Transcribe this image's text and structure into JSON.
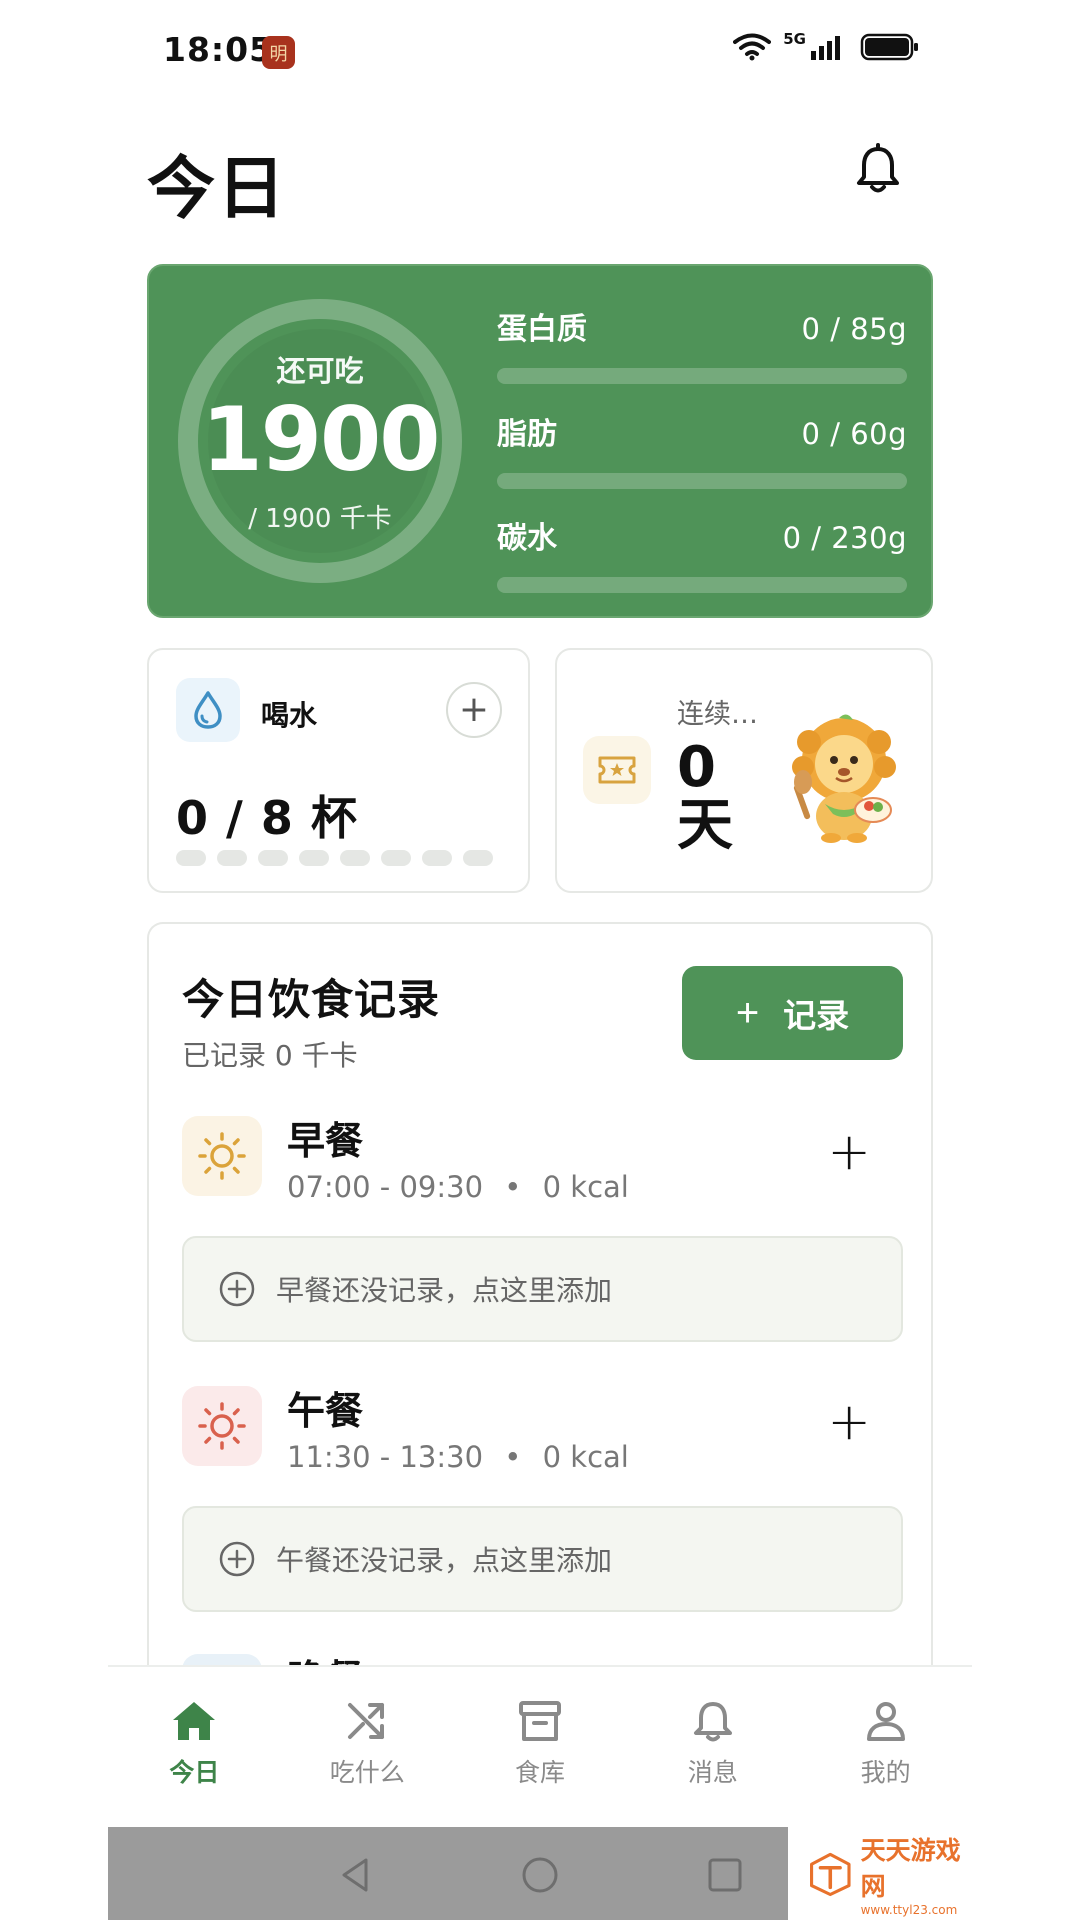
{
  "status_bar": {
    "time": "18:05",
    "app_badge": "明",
    "network": "5G",
    "icons": [
      "wifi-icon",
      "signal-icon",
      "battery-icon"
    ]
  },
  "header": {
    "title": "今日",
    "icon": "bell-icon"
  },
  "summary": {
    "remaining_label": "还可吃",
    "remaining_value": "1900",
    "target_text": "/ 1900 千卡",
    "remaining_fraction": 1.0,
    "macros": [
      {
        "name": "蛋白质",
        "value": "0 / 85g",
        "progress": 0
      },
      {
        "name": "脂肪",
        "value": "0 / 60g",
        "progress": 0
      },
      {
        "name": "碳水",
        "value": "0 / 230g",
        "progress": 0
      }
    ]
  },
  "water": {
    "title": "喝水",
    "count": "0 / 8 杯",
    "cups_total": 8,
    "cups_filled": 0,
    "icon": "water-drop-icon",
    "add_label": "+"
  },
  "streak": {
    "label": "连续…",
    "value": "0",
    "unit": "天",
    "icon": "ticket-star-icon",
    "mascot": "lion-mascot"
  },
  "food_log": {
    "title": "今日饮食记录",
    "subtitle": "已记录 0 千卡",
    "record_button": {
      "plus": "+",
      "label": "记录"
    },
    "meals": [
      {
        "name": "早餐",
        "time": "07:00 - 09:30",
        "kcal": "0 kcal",
        "empty_text": "早餐还没记录，点这里添加",
        "icon": "sun-icon",
        "add": "+"
      },
      {
        "name": "午餐",
        "time": "11:30 - 13:30",
        "kcal": "0 kcal",
        "empty_text": "午餐还没记录，点这里添加",
        "icon": "sun-icon",
        "add": "+"
      },
      {
        "name": "晚餐"
      }
    ],
    "separator": "•"
  },
  "tabs": [
    {
      "label": "今日",
      "icon": "home-icon",
      "active": true
    },
    {
      "label": "吃什么",
      "icon": "shuffle-icon",
      "active": false
    },
    {
      "label": "食库",
      "icon": "archive-box-icon",
      "active": false
    },
    {
      "label": "消息",
      "icon": "bell-icon",
      "active": false
    },
    {
      "label": "我的",
      "icon": "user-icon",
      "active": false
    }
  ],
  "watermark": {
    "title": "天天游戏网",
    "url": "www.ttyl23.com"
  },
  "colors": {
    "brand_green": "#4f9358",
    "active_tab": "#3e8449"
  }
}
